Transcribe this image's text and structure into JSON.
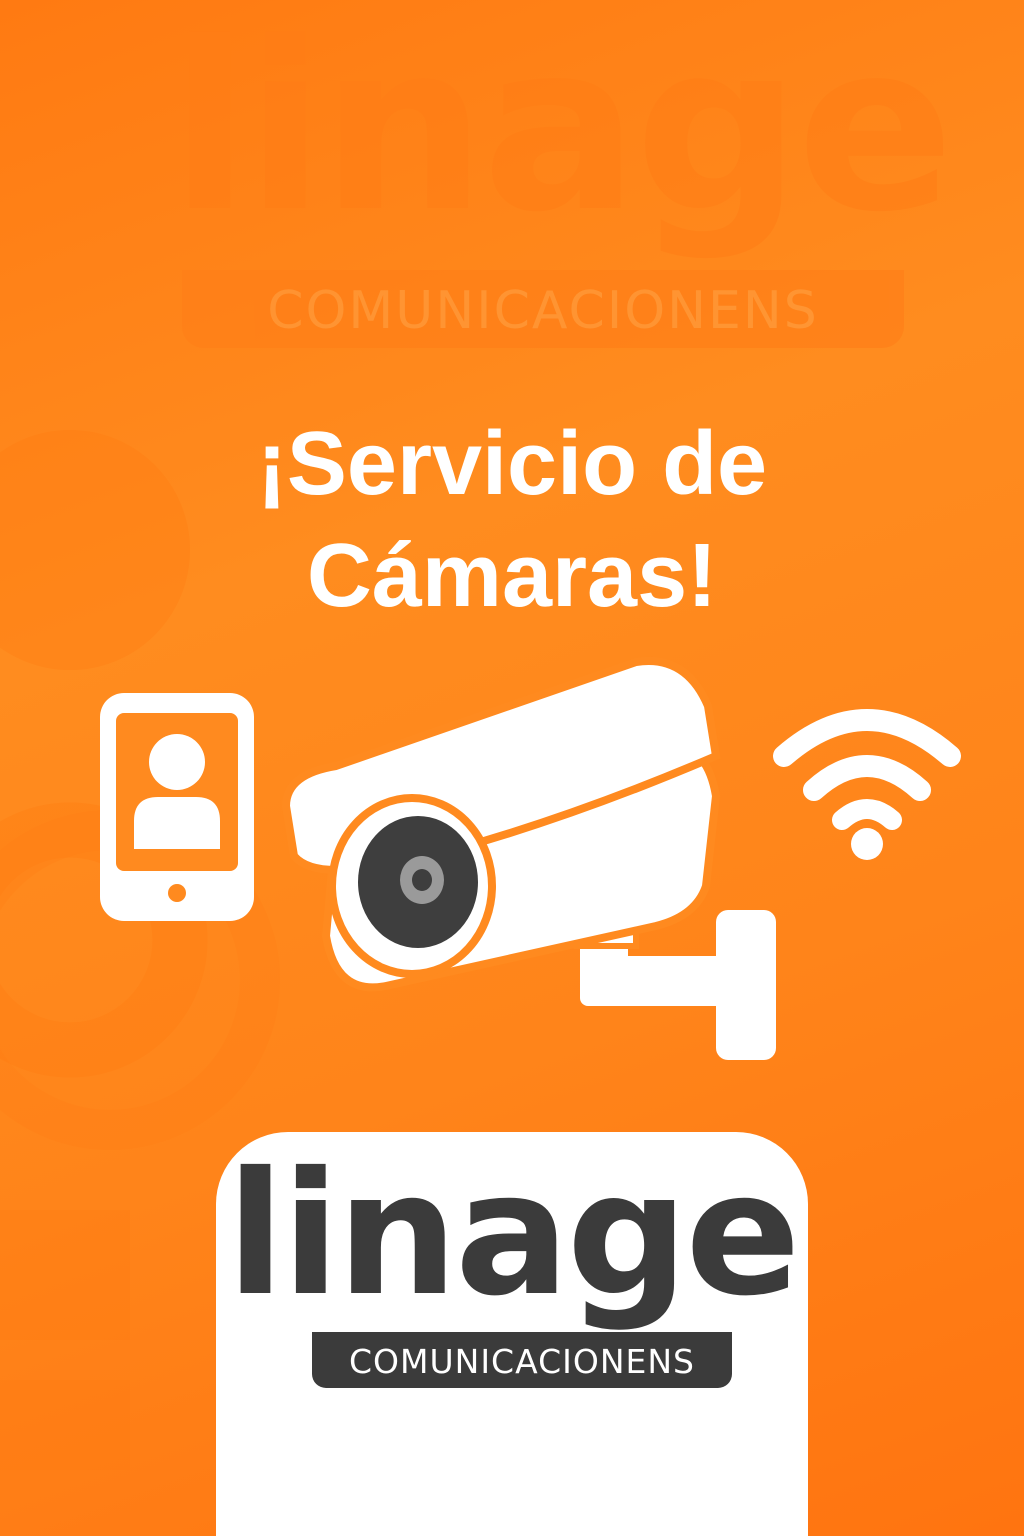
{
  "brand": {
    "name": "linage",
    "tagline": "COMUNICACIONENS"
  },
  "headline": {
    "line1": "¡Servicio de",
    "line2": "Cámaras!"
  },
  "icons": [
    "smartphone-user-icon",
    "security-camera-icon",
    "wifi-icon"
  ],
  "colors": {
    "background": "#ff8a1f",
    "text": "#ffffff",
    "logo_dark": "#3b3b3b",
    "card": "#ffffff"
  }
}
